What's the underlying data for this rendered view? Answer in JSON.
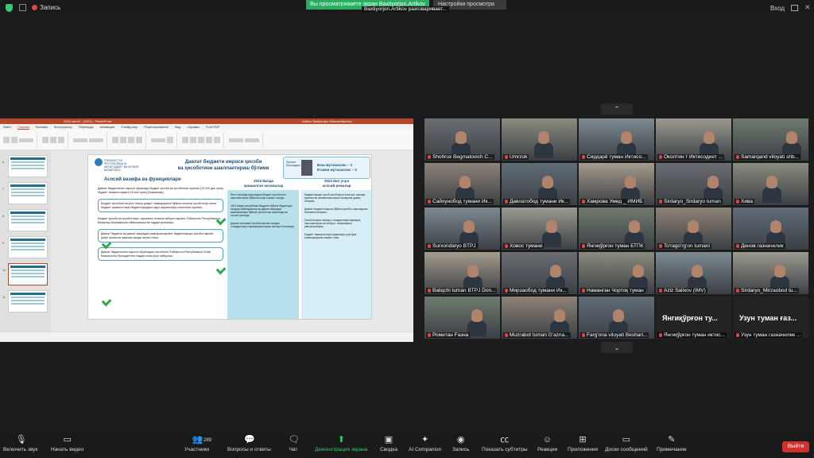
{
  "topbar": {
    "record_label": "Запись",
    "share_banner": "Вы просматриваете экран Baxtiyorjon.Artikov",
    "view_settings": "Настройки просмотра",
    "speaking": "Baxtiyorjon.Artikov разговаривает...",
    "exit_fullscreen": "Вход"
  },
  "ppt": {
    "title": "2024 хисоб - (2024) - PowerPoint",
    "user": "Artikov Baxtiyorjon Mamasoliyevich",
    "tabs": [
      "Файл",
      "Главная",
      "Вставка",
      "Конструктор",
      "Переходы",
      "Анимация",
      "Слайд-шоу",
      "Рецензирование",
      "Вид",
      "Справка",
      "Foxit PDF"
    ],
    "slide": {
      "ministry": "ЎЗБЕКИСТОН РЕСПУБЛИКАСИ ИҚТИСОДИЁТ ВА МОЛИЯ ВАЗИРЛИГИ",
      "title_line1": "Давлат бюджети ижроси ҳисоби",
      "title_line2": "ва ҳисоботини шакллантириш бўлими",
      "person_name": "Ярлиев Бахриддин",
      "quota_line1": "Бош мутахассис – 2",
      "quota_line2": "Етакчи мутахассис – 2",
      "left_heading": "Асосий вазифа ва функциялари",
      "mid_head_line1": "2023 йилда",
      "mid_head_line2": "эришилган натижалар",
      "right_head_line1": "2024 йил учун",
      "right_head_line2": "асосий режалар",
      "left_texts": [
        "Давлат бюджетининг ижроси тўғрисида бюджет ҳисоби ва ҳисоботини юритиш (29 000 дан ортиқ бюджет ташкилотларига 16 млн ортиқ ўтказмалар).",
        "Бюджет ҳисобини ва унга тезкор кредит ликвидацияси бўйича нохолис ҳисоботлар ягона бюджет ташкилотлари бюджетларидаги ижро жараёнлари таҳлилини юритиш.",
        "Бюджет ҳисоби ва ҳисоботлари, ҳаракатга тегишли ахборотларнинг Ўзбекистон Республикаси Вазирлар Маҳкамасига тайёрланиши ва тақдим қилиниши.",
        "Давлат бюджети ва давлат мақсадли жамғармаларнинг бюджетлараро ҳисоботларини қабул қилиш ва жамлаш ҳамда таҳлил этиш.",
        "Давлат бюджетининг ижроси тўғрисидаги ҳисоботни Ўзбекистон Республикаси Олий Мажлиси ва Президентига тақдим этиш учун тайёрлаш."
      ],
      "mid_texts": [
        "Янги тартибда ижросидаги бюджет ҳисоботини шакллантириш бўйича ишлар ташкил этилди.",
        "2024 йилда республика бюджети бўйича бюджетдан ташқари жамғармалар ва давлат мақсадли жамғармалари бўйича ҳисоботлар жамланди ва таҳлил қилинди.",
        "Давлат молиявий ҳисоботларини халқаро стандартларга мувофиқлаштириш ишлари бошланди."
      ],
      "right_texts": [
        "Бюджетлараро ҳисоб-китобларни электрон шаклда юритиш ва автоматлаштириш ишларини давом эттириш.",
        "Давлат бюджети ижроси бўйича ҳисобот шаклларини такомиллаштириш.",
        "Ҳисоботларни халқаро стандартларга мувофиқ шакллантириш ва ахборот тизимларини ривожлантириш.",
        "Бюджет ташкилотлари ходимлари учун ўқув семинарларини ташкил этиш."
      ]
    }
  },
  "participants": [
    {
      "name": "Shohrux Begmatovich C...",
      "muted": true
    },
    {
      "name": "Umrzok",
      "muted": true
    },
    {
      "name": "Сирдарё туман Иктисо...",
      "muted": true
    },
    {
      "name": "Околтин т Иктисодиет ...",
      "muted": true
    },
    {
      "name": "Samarqand viloyati shb...",
      "muted": true
    },
    {
      "name": "Сайхунобод тумани Ик...",
      "muted": true
    },
    {
      "name": "Давлатобод тумани Ик...",
      "muted": true
    },
    {
      "name": "Хамрова Умид _ ИМИБ",
      "muted": true
    },
    {
      "name": "Sirdaryo_Sirdaryo tuman",
      "muted": true
    },
    {
      "name": "Хива",
      "muted": true
    },
    {
      "name": "Surxondaryo BTPJ",
      "muted": true
    },
    {
      "name": "Ховос тумани",
      "muted": true
    },
    {
      "name": "Янгиқўрғон туман БТПК",
      "muted": true
    },
    {
      "name": "To'rago'rg'on tumani",
      "muted": true
    },
    {
      "name": "Денов газначилик",
      "muted": true
    },
    {
      "name": "Baliqchi tuman BTPJ Don...",
      "muted": true
    },
    {
      "name": "Мирзаобод тумани Ик...",
      "muted": true
    },
    {
      "name": "Наманган Чортоқ туман",
      "muted": true
    },
    {
      "name": "Aziz Salixov (IMV)",
      "muted": true
    },
    {
      "name": "Sirdaryo_Mirzaobod tu...",
      "muted": true
    },
    {
      "name": "Ромитан Fазна",
      "muted": true
    },
    {
      "name": "Muzrabot tuman G'azna...",
      "muted": true
    },
    {
      "name": "Farg'ona viloyati Beshari...",
      "muted": true
    },
    {
      "name": "Янгиқўрғон туман иктис...",
      "muted": true,
      "big": "Янгиқўрғон ту..."
    },
    {
      "name": "Узун туман газначилик ...",
      "muted": true,
      "big": "Узун туман ғаз..."
    }
  ],
  "toolbar": {
    "unmute": "Включить звук",
    "video": "Начать видео",
    "participants": "Участники",
    "participants_count": "289",
    "qa": "Вопросы и ответы",
    "chat": "Чат",
    "share": "Демонстрация экрана",
    "summary": "Сводка",
    "ai": "AI Companion",
    "record": "Запись",
    "captions": "Показать субтитры",
    "reactions": "Реакции",
    "apps": "Приложения",
    "boards": "Доски сообщений",
    "notes": "Примечание",
    "leave": "Выйти"
  },
  "colors": {
    "accent_green": "#2ecc71",
    "leave_red": "#d0312d",
    "ppt_red": "#b7472a",
    "slide_blue": "#1f4e79"
  }
}
